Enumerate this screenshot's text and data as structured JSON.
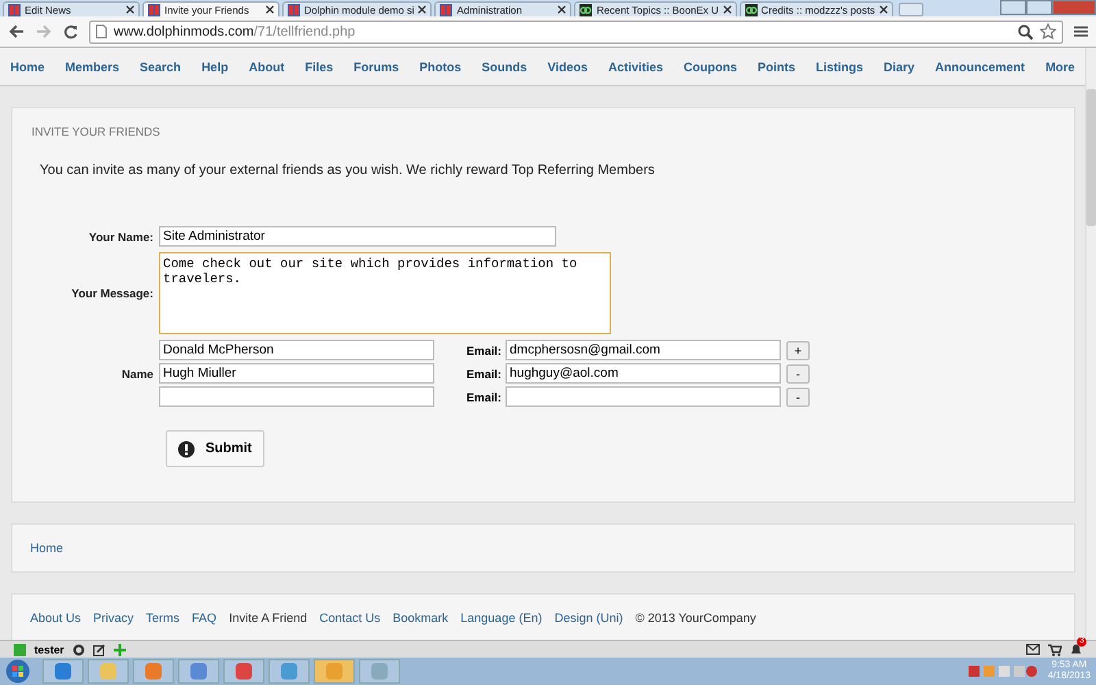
{
  "browser": {
    "tabs": [
      {
        "title": "Edit News",
        "selected": false,
        "kind": "dolphin"
      },
      {
        "title": "Invite your Friends",
        "selected": true,
        "kind": "dolphin"
      },
      {
        "title": "Dolphin module demo si",
        "selected": false,
        "kind": "dolphin"
      },
      {
        "title": "Administration",
        "selected": false,
        "kind": "dolphin"
      },
      {
        "title": "Recent Topics :: BoonEx U",
        "selected": false,
        "kind": "boonex"
      },
      {
        "title": "Credits :: modzzz's posts",
        "selected": false,
        "kind": "boonex"
      }
    ],
    "address": {
      "domain": "www.dolphinmods.com",
      "path": "/71/tellfriend.php"
    }
  },
  "nav": {
    "items": [
      {
        "label": "Home"
      },
      {
        "label": "Members"
      },
      {
        "label": "Search"
      },
      {
        "label": "Help"
      },
      {
        "label": "About"
      },
      {
        "label": "Files"
      },
      {
        "label": "Forums"
      },
      {
        "label": "Photos"
      },
      {
        "label": "Sounds"
      },
      {
        "label": "Videos"
      },
      {
        "label": "Activities"
      },
      {
        "label": "Coupons"
      },
      {
        "label": "Points"
      },
      {
        "label": "Listings"
      },
      {
        "label": "Diary"
      },
      {
        "label": "Announcement"
      },
      {
        "label": "More"
      }
    ]
  },
  "invite": {
    "heading": "INVITE YOUR FRIENDS",
    "intro": "You can invite as many of your external friends as you wish. We richly reward Top Referring Members",
    "your_name": {
      "label": "Your Name:",
      "value": "Site Administrator"
    },
    "message": {
      "label": "Your Message:",
      "value": "Come check out our site which provides information to travelers."
    },
    "friends": {
      "name_label": "Name",
      "rows": [
        {
          "name": "Donald McPherson",
          "email_label": "Email:",
          "email": "dmcphersosn@gmail.com",
          "button": "+"
        },
        {
          "name": "Hugh Miuller",
          "email_label": "Email:",
          "email": "hughguy@aol.com",
          "button": "-"
        },
        {
          "name": "",
          "email_label": "Email:",
          "email": "",
          "button": "-"
        }
      ]
    },
    "submit": "Submit"
  },
  "breadcrumb": {
    "label": "Home"
  },
  "footer": {
    "links": [
      {
        "label": "About Us",
        "kind": "link"
      },
      {
        "label": "Privacy",
        "kind": "link"
      },
      {
        "label": "Terms",
        "kind": "link"
      },
      {
        "label": "FAQ",
        "kind": "link"
      },
      {
        "label": "Invite A Friend",
        "kind": "text"
      },
      {
        "label": "Contact Us",
        "kind": "link"
      },
      {
        "label": "Bookmark",
        "kind": "link"
      },
      {
        "label": "Language (En)",
        "kind": "link"
      },
      {
        "label": "Design (Uni)",
        "kind": "link"
      }
    ],
    "copyright": "© 2013 YourCompany"
  },
  "bottom_bar": {
    "user": "tester",
    "notification_count": "3"
  },
  "taskbar": {
    "time": "9:53 AM",
    "date": "4/18/2013"
  }
}
